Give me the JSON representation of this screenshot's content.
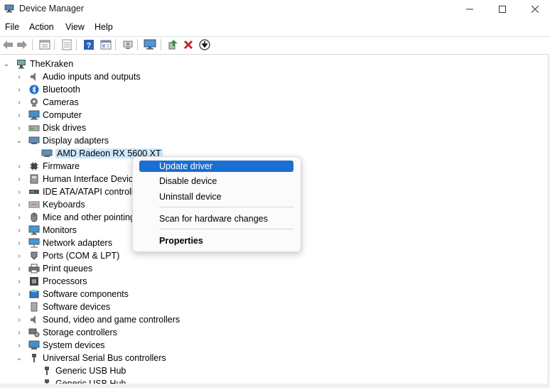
{
  "window": {
    "title": "Device Manager"
  },
  "menu": [
    "File",
    "Action",
    "View",
    "Help"
  ],
  "toolbar_icons": [
    "back-arrow-icon",
    "forward-arrow-icon",
    "properties-icon",
    "list-icon",
    "help-icon",
    "view-icon",
    "scan-hardware-icon",
    "monitor-icon",
    "update-driver-icon",
    "uninstall-icon",
    "download-icon"
  ],
  "tree": {
    "root": "TheKraken",
    "categories": [
      {
        "label": "Audio inputs and outputs",
        "icon": "speaker-icon",
        "expanded": false
      },
      {
        "label": "Bluetooth",
        "icon": "bluetooth-icon",
        "expanded": false
      },
      {
        "label": "Cameras",
        "icon": "camera-icon",
        "expanded": false
      },
      {
        "label": "Computer",
        "icon": "computer-icon",
        "expanded": false
      },
      {
        "label": "Disk drives",
        "icon": "disk-icon",
        "expanded": false
      },
      {
        "label": "Display adapters",
        "icon": "display-adapter-icon",
        "expanded": true,
        "children": [
          "AMD Radeon RX 5600 XT"
        ]
      },
      {
        "label": "Firmware",
        "icon": "firmware-icon",
        "expanded": false
      },
      {
        "label": "Human Interface Device",
        "icon": "hid-icon",
        "expanded": false
      },
      {
        "label": "IDE ATA/ATAPI controlle",
        "icon": "ide-icon",
        "expanded": false
      },
      {
        "label": "Keyboards",
        "icon": "keyboard-icon",
        "expanded": false
      },
      {
        "label": "Mice and other pointing",
        "icon": "mouse-icon",
        "expanded": false
      },
      {
        "label": "Monitors",
        "icon": "monitor-icon",
        "expanded": false
      },
      {
        "label": "Network adapters",
        "icon": "network-icon",
        "expanded": false
      },
      {
        "label": "Ports (COM & LPT)",
        "icon": "port-icon",
        "expanded": false
      },
      {
        "label": "Print queues",
        "icon": "printer-icon",
        "expanded": false
      },
      {
        "label": "Processors",
        "icon": "processor-icon",
        "expanded": false
      },
      {
        "label": "Software components",
        "icon": "software-component-icon",
        "expanded": false
      },
      {
        "label": "Software devices",
        "icon": "software-device-icon",
        "expanded": false
      },
      {
        "label": "Sound, video and game controllers",
        "icon": "sound-icon",
        "expanded": false
      },
      {
        "label": "Storage controllers",
        "icon": "storage-icon",
        "expanded": false
      },
      {
        "label": "System devices",
        "icon": "system-icon",
        "expanded": false
      },
      {
        "label": "Universal Serial Bus controllers",
        "icon": "usb-icon",
        "expanded": true,
        "children": [
          "Generic USB Hub",
          "Generic USB Hub"
        ]
      }
    ]
  },
  "context_menu": {
    "items": [
      "Update driver",
      "Disable device",
      "Uninstall device",
      "Scan for hardware changes",
      "Properties"
    ],
    "highlighted": "Update driver"
  }
}
